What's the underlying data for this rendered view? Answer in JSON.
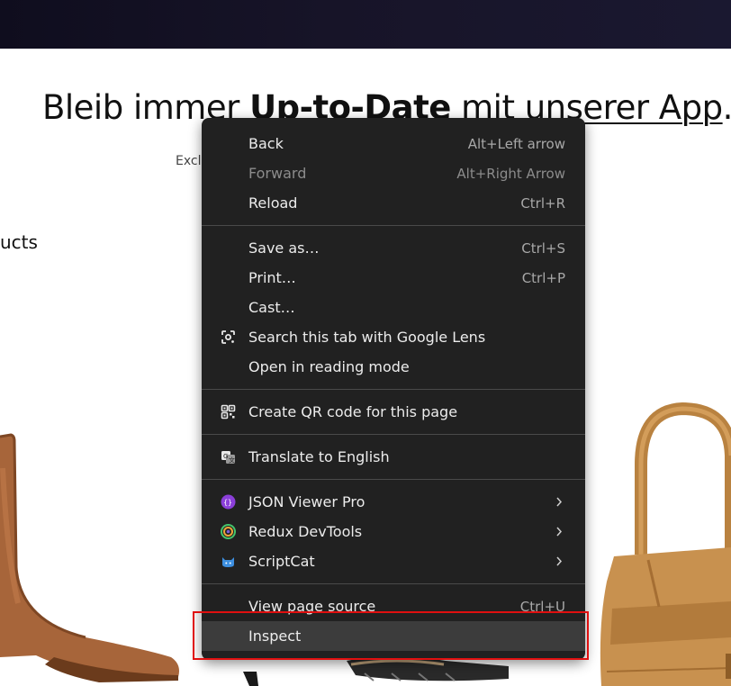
{
  "headline": {
    "part1": "Bleib immer ",
    "bold": "Up-to-Date",
    "part2": " mit ",
    "link": "unserer App",
    "part3": "."
  },
  "subtext": "Excl",
  "products_fragment": "ucts",
  "context_menu": {
    "back": {
      "label": "Back",
      "shortcut": "Alt+Left arrow"
    },
    "forward": {
      "label": "Forward",
      "shortcut": "Alt+Right Arrow"
    },
    "reload": {
      "label": "Reload",
      "shortcut": "Ctrl+R"
    },
    "save_as": {
      "label": "Save as…",
      "shortcut": "Ctrl+S"
    },
    "print": {
      "label": "Print…",
      "shortcut": "Ctrl+P"
    },
    "cast": {
      "label": "Cast…"
    },
    "lens": {
      "label": "Search this tab with Google Lens",
      "icon": "google-lens-icon"
    },
    "reading_mode": {
      "label": "Open in reading mode"
    },
    "qr": {
      "label": "Create QR code for this page",
      "icon": "qr-code-icon"
    },
    "translate": {
      "label": "Translate to English",
      "icon": "translate-icon"
    },
    "json_viewer": {
      "label": "JSON Viewer Pro",
      "icon": "json-viewer-icon"
    },
    "redux": {
      "label": "Redux DevTools",
      "icon": "redux-icon"
    },
    "scriptcat": {
      "label": "ScriptCat",
      "icon": "scriptcat-icon"
    },
    "view_source": {
      "label": "View page source",
      "shortcut": "Ctrl+U"
    },
    "inspect": {
      "label": "Inspect"
    }
  },
  "colors": {
    "menu_bg": "#212121",
    "highlight": "#3c3c3c",
    "annotation": "#e01010"
  }
}
